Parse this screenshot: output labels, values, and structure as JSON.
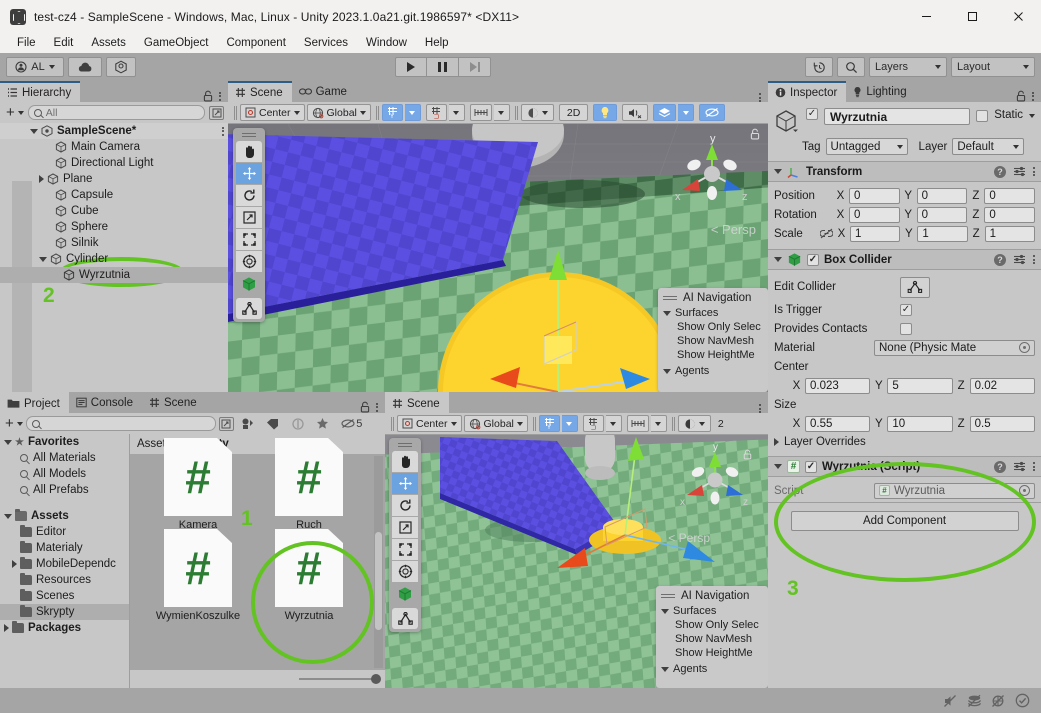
{
  "window": {
    "title": "test-cz4 - SampleScene - Windows, Mac, Linux - Unity 2023.1.0a21.git.1986597* <DX11>",
    "app_icon": "unity-icon",
    "minimize": "minimize-icon",
    "maximize": "maximize-icon",
    "close": "close-icon"
  },
  "menubar": {
    "items": [
      "File",
      "Edit",
      "Assets",
      "GameObject",
      "Component",
      "Services",
      "Window",
      "Help"
    ]
  },
  "toolbar": {
    "account_label": "AL",
    "cloud_icon": "cloud-icon",
    "package_icon": "unity-package-icon",
    "play": "play-icon",
    "pause": "pause-icon",
    "step": "step-icon",
    "history_icon": "undo-history-icon",
    "search_icon": "search-icon",
    "layers_label": "Layers",
    "layout_label": "Layout"
  },
  "hierarchy": {
    "tab": "Hierarchy",
    "lock_icon": "lock-icon",
    "menu_icon": "kebab-menu-icon",
    "add_label": "+",
    "search_placeholder": "All",
    "scene_name": "SampleScene*",
    "items": [
      {
        "label": "Main Camera",
        "depth": 2,
        "expandable": false,
        "selected": false
      },
      {
        "label": "Directional Light",
        "depth": 2,
        "expandable": false,
        "selected": false
      },
      {
        "label": "Plane",
        "depth": 2,
        "expandable": true,
        "expanded": false,
        "selected": false
      },
      {
        "label": "Capsule",
        "depth": 2,
        "expandable": false,
        "selected": false
      },
      {
        "label": "Cube",
        "depth": 2,
        "expandable": false,
        "selected": false
      },
      {
        "label": "Sphere",
        "depth": 2,
        "expandable": false,
        "selected": false
      },
      {
        "label": "Silnik",
        "depth": 2,
        "expandable": false,
        "selected": false
      },
      {
        "label": "Cylinder",
        "depth": 1,
        "expandable": true,
        "expanded": true,
        "selected": false
      },
      {
        "label": "Wyrzutnia",
        "depth": 2,
        "expandable": false,
        "selected": true
      }
    ]
  },
  "scene_panel": {
    "tabs": [
      {
        "label": "Scene",
        "icon": "grid-icon",
        "active": true
      },
      {
        "label": "Game",
        "icon": "gamepad-icon",
        "active": false
      }
    ],
    "menu_icon": "kebab-menu-icon",
    "toolbar": {
      "pivot_label": "Center",
      "pivot_icon": "pivot-center-icon",
      "space_label": "Global",
      "space_icon": "globe-icon",
      "grid_snap_icon": "grid-axis-y-icon",
      "snap_increment_icon": "grid-snap-icon",
      "ruler_icon": "ruler-icon",
      "shading_icon": "shading-mode-icon",
      "twod_label": "2D",
      "light_icon": "lightbulb-icon",
      "audio_icon": "audio-mute-icon",
      "fx_icon": "effects-icon",
      "hidden_icon": "scene-visibility-icon"
    },
    "tools": [
      {
        "name": "hand-tool",
        "selected": false
      },
      {
        "name": "move-tool",
        "selected": true
      },
      {
        "name": "rotate-tool",
        "selected": false
      },
      {
        "name": "scale-tool",
        "selected": false
      },
      {
        "name": "rect-tool",
        "selected": false
      },
      {
        "name": "transform-tool",
        "selected": false
      },
      {
        "name": "custom-editor-tool",
        "selected": false
      },
      {
        "name": "collider-edit-tool",
        "selected": false
      }
    ],
    "overlay": {
      "title": "AI Navigation",
      "surfaces_label": "Surfaces",
      "surface_options": [
        "Show Only Selec",
        "Show NavMesh",
        "Show HeightMe"
      ],
      "agents_label": "Agents"
    },
    "persp_label": "< Persp",
    "gizmo_axes": {
      "y": "y",
      "x": "x",
      "z": "z"
    }
  },
  "scene_panel2": {
    "tabs": [
      {
        "label": "Scene",
        "icon": "grid-icon",
        "active": true
      }
    ],
    "menu_icon": "kebab-menu-icon",
    "toolbar": {
      "pivot_label": "Center",
      "space_label": "Global",
      "twod_label": "2"
    },
    "overlay": {
      "title": "AI Navigation",
      "surfaces_label": "Surfaces",
      "surface_options": [
        "Show Only Selec",
        "Show NavMesh",
        "Show HeightMe"
      ],
      "agents_label": "Agents"
    },
    "persp_label": "< Persp",
    "gizmo_axes": {
      "y": "y",
      "x": "x",
      "z": "z"
    }
  },
  "project": {
    "tabs": [
      {
        "label": "Project",
        "icon": "folder-icon",
        "active": true
      },
      {
        "label": "Console",
        "icon": "console-icon",
        "active": false
      },
      {
        "label": "Scene",
        "icon": "grid-icon",
        "active": false
      }
    ],
    "lock_icon": "lock-icon",
    "menu_icon": "kebab-menu-icon",
    "add_label": "+",
    "search_placeholder": "",
    "filter_icons": [
      "asset-type-filter-icon",
      "label-filter-icon",
      "saved-search-icon",
      "favorite-star-icon"
    ],
    "hidden_count": "5",
    "tree": [
      {
        "label": "Favorites",
        "depth": 0,
        "bold": true,
        "expanded": true,
        "icon": "star-icon"
      },
      {
        "label": "All Materials",
        "depth": 1,
        "icon": "search-icon"
      },
      {
        "label": "All Models",
        "depth": 1,
        "icon": "search-icon"
      },
      {
        "label": "All Prefabs",
        "depth": 1,
        "icon": "search-icon"
      },
      {
        "label": "Assets",
        "depth": 0,
        "bold": true,
        "expanded": true,
        "icon": "folder-open-icon"
      },
      {
        "label": "Editor",
        "depth": 1,
        "icon": "folder-icon"
      },
      {
        "label": "Materialy",
        "depth": 1,
        "icon": "folder-icon"
      },
      {
        "label": "MobileDependc",
        "depth": 1,
        "icon": "folder-icon",
        "expandable": true
      },
      {
        "label": "Resources",
        "depth": 1,
        "icon": "folder-icon"
      },
      {
        "label": "Scenes",
        "depth": 1,
        "icon": "folder-icon"
      },
      {
        "label": "Skrypty",
        "depth": 1,
        "icon": "folder-icon",
        "selected": true
      },
      {
        "label": "Packages",
        "depth": 0,
        "bold": true,
        "expandable": true,
        "icon": "folder-icon"
      }
    ],
    "breadcrumb": [
      "Assets",
      "Skrypty"
    ],
    "assets": [
      {
        "name": "Kamera",
        "icon": "csharp-script-icon"
      },
      {
        "name": "Ruch",
        "icon": "csharp-script-icon"
      },
      {
        "name": "WymienKoszulke",
        "icon": "csharp-script-icon"
      },
      {
        "name": "Wyrzutnia",
        "icon": "csharp-script-icon",
        "highlighted": true
      }
    ]
  },
  "inspector": {
    "tabs": [
      {
        "label": "Inspector",
        "icon": "info-icon",
        "active": true
      },
      {
        "label": "Lighting",
        "icon": "lightbulb-icon",
        "active": false
      }
    ],
    "lock_icon": "lock-icon",
    "menu_icon": "kebab-menu-icon",
    "object_name": "Wyrzutnia",
    "enabled": true,
    "static_label": "Static",
    "tag_label": "Tag",
    "tag_value": "Untagged",
    "layer_label": "Layer",
    "layer_value": "Default",
    "components": [
      {
        "title": "Transform",
        "icon": "transform-icon",
        "rows": [
          {
            "label": "Position",
            "x": "0",
            "y": "0",
            "z": "0"
          },
          {
            "label": "Rotation",
            "x": "0",
            "y": "0",
            "z": "0"
          },
          {
            "label": "Scale",
            "x": "1",
            "y": "1",
            "z": "1",
            "link_icon": "scale-link-off-icon"
          }
        ]
      },
      {
        "title": "Box Collider",
        "icon": "box-collider-icon",
        "enabled": true,
        "edit_collider_label": "Edit Collider",
        "edit_collider_icon": "edit-collider-icon",
        "is_trigger_label": "Is Trigger",
        "is_trigger": true,
        "provides_contacts_label": "Provides Contacts",
        "provides_contacts": false,
        "material_label": "Material",
        "material_value": "None (Physic Mate",
        "center_label": "Center",
        "center": {
          "x": "0.023",
          "y": "5",
          "z": "0.02"
        },
        "size_label": "Size",
        "size": {
          "x": "0.55",
          "y": "10",
          "z": "0.5"
        },
        "layer_overrides_label": "Layer Overrides"
      },
      {
        "title": "Wyrzutnia (Script)",
        "icon": "csharp-script-icon",
        "enabled": true,
        "script_label": "Script",
        "script_value": "Wyrzutnia"
      }
    ],
    "add_component_label": "Add Component",
    "axis_labels": {
      "x": "X",
      "y": "Y",
      "z": "Z"
    }
  },
  "statusbar": {
    "icons": [
      "mute-audio-icon",
      "layers-stack-icon",
      "preview-off-icon",
      "check-circle-icon"
    ]
  },
  "annotations": {
    "color": "#63c322",
    "markers": [
      {
        "number": "1",
        "target": "project-asset-wyrzutnia"
      },
      {
        "number": "2",
        "target": "hierarchy-item-wyrzutnia"
      },
      {
        "number": "3",
        "target": "inspector-wyrzutnia-script-component"
      }
    ]
  }
}
